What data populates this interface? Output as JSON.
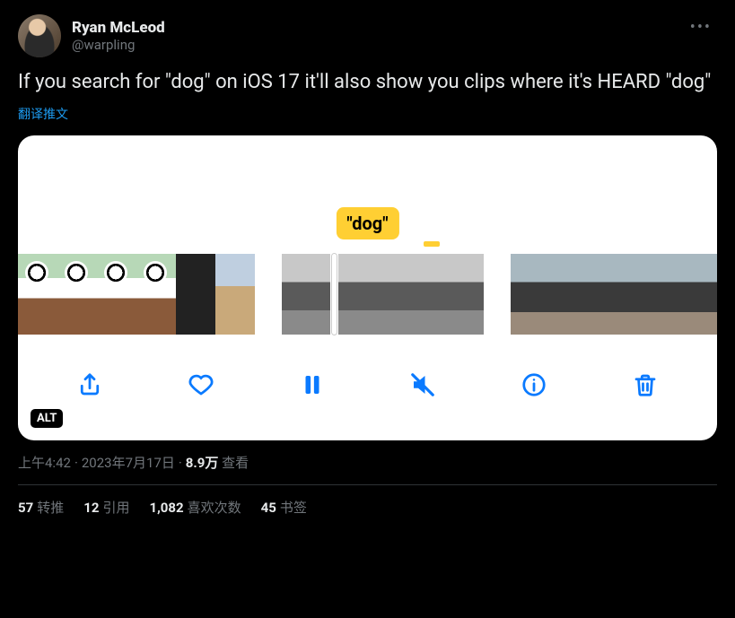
{
  "author": {
    "display_name": "Ryan McLeod",
    "handle": "@warpling"
  },
  "tweet_text": "If you search for \"dog\" on iOS 17 it'll also show you clips where it's HEARD \"dog\"",
  "translate_label": "翻译推文",
  "media": {
    "tag_bubble": "\"dog\"",
    "alt_badge": "ALT"
  },
  "meta": {
    "time": "上午4:42",
    "date": "2023年7月17日",
    "views_count": "8.9万",
    "views_label": "查看"
  },
  "stats": {
    "retweets_count": "57",
    "retweets_label": "转推",
    "quotes_count": "12",
    "quotes_label": "引用",
    "likes_count": "1,082",
    "likes_label": "喜欢次数",
    "bookmarks_count": "45",
    "bookmarks_label": "书签"
  }
}
